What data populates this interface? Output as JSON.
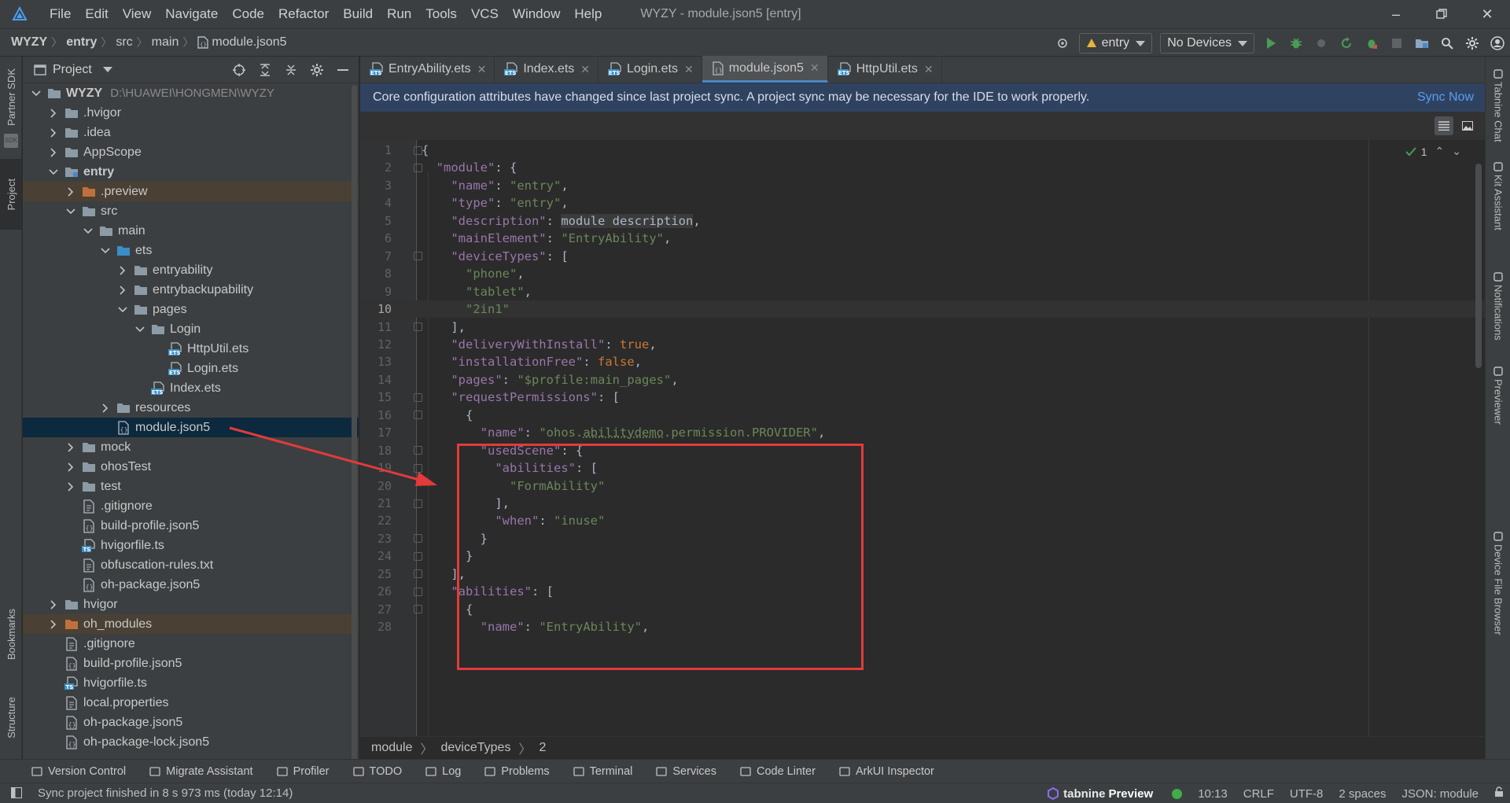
{
  "menubar": {
    "items": [
      "File",
      "Edit",
      "View",
      "Navigate",
      "Code",
      "Refactor",
      "Build",
      "Run",
      "Tools",
      "VCS",
      "Window",
      "Help"
    ],
    "window_title": "WYZY - module.json5 [entry]"
  },
  "navbar": {
    "breadcrumb": [
      "WYZY",
      "entry",
      "src",
      "main",
      "module.json5"
    ],
    "module_combo": "entry",
    "device_combo": "No Devices"
  },
  "left_strip": {
    "tabs": [
      "Partner SDK",
      "Project",
      "Bookmarks",
      "Structure"
    ]
  },
  "project": {
    "title": "Project",
    "root_path": "D:\\HUAWEI\\HONGMEN\\WYZY",
    "tree": [
      {
        "label": "WYZY",
        "depth": 0,
        "open": true,
        "icon": "folder-icon",
        "bold": true
      },
      {
        "label": ".hvigor",
        "depth": 1,
        "open": false,
        "icon": "folder-icon"
      },
      {
        "label": ".idea",
        "depth": 1,
        "open": false,
        "icon": "folder-icon"
      },
      {
        "label": "AppScope",
        "depth": 1,
        "open": false,
        "icon": "folder-icon"
      },
      {
        "label": "entry",
        "depth": 1,
        "open": true,
        "icon": "module-folder-icon",
        "bold": true
      },
      {
        "label": ".preview",
        "depth": 2,
        "open": false,
        "icon": "orange-folder-icon",
        "highlight": true
      },
      {
        "label": "src",
        "depth": 2,
        "open": true,
        "icon": "folder-icon"
      },
      {
        "label": "main",
        "depth": 3,
        "open": true,
        "icon": "folder-icon"
      },
      {
        "label": "ets",
        "depth": 4,
        "open": true,
        "icon": "blue-folder-icon"
      },
      {
        "label": "entryability",
        "depth": 5,
        "open": false,
        "icon": "folder-icon"
      },
      {
        "label": "entrybackupability",
        "depth": 5,
        "open": false,
        "icon": "folder-icon"
      },
      {
        "label": "pages",
        "depth": 5,
        "open": true,
        "icon": "folder-icon"
      },
      {
        "label": "Login",
        "depth": 6,
        "open": true,
        "icon": "folder-icon"
      },
      {
        "label": "HttpUtil.ets",
        "depth": 7,
        "icon": "ets-file-icon"
      },
      {
        "label": "Login.ets",
        "depth": 7,
        "icon": "ets-file-icon"
      },
      {
        "label": "Index.ets",
        "depth": 6,
        "icon": "ets-file-icon"
      },
      {
        "label": "resources",
        "depth": 4,
        "open": false,
        "icon": "folder-icon"
      },
      {
        "label": "module.json5",
        "depth": 4,
        "icon": "json-file-icon",
        "selected": true
      },
      {
        "label": "mock",
        "depth": 2,
        "open": false,
        "icon": "folder-icon"
      },
      {
        "label": "ohosTest",
        "depth": 2,
        "open": false,
        "icon": "folder-icon"
      },
      {
        "label": "test",
        "depth": 2,
        "open": false,
        "icon": "folder-icon"
      },
      {
        "label": ".gitignore",
        "depth": 2,
        "icon": "text-file-icon"
      },
      {
        "label": "build-profile.json5",
        "depth": 2,
        "icon": "json-file-icon"
      },
      {
        "label": "hvigorfile.ts",
        "depth": 2,
        "icon": "ts-file-icon"
      },
      {
        "label": "obfuscation-rules.txt",
        "depth": 2,
        "icon": "text-file-icon"
      },
      {
        "label": "oh-package.json5",
        "depth": 2,
        "icon": "json-file-icon"
      },
      {
        "label": "hvigor",
        "depth": 1,
        "open": false,
        "icon": "folder-icon"
      },
      {
        "label": "oh_modules",
        "depth": 1,
        "open": false,
        "icon": "orange-folder-icon",
        "highlight": true
      },
      {
        "label": ".gitignore",
        "depth": 1,
        "icon": "text-file-icon"
      },
      {
        "label": "build-profile.json5",
        "depth": 1,
        "icon": "json-file-icon"
      },
      {
        "label": "hvigorfile.ts",
        "depth": 1,
        "icon": "ts-file-icon"
      },
      {
        "label": "local.properties",
        "depth": 1,
        "icon": "text-file-icon"
      },
      {
        "label": "oh-package.json5",
        "depth": 1,
        "icon": "json-file-icon"
      },
      {
        "label": "oh-package-lock.json5",
        "depth": 1,
        "icon": "json-file-icon"
      }
    ]
  },
  "editor": {
    "tabs": [
      {
        "label": "EntryAbility.ets",
        "icon": "ets-file-icon"
      },
      {
        "label": "Index.ets",
        "icon": "ets-file-icon"
      },
      {
        "label": "Login.ets",
        "icon": "ets-file-icon"
      },
      {
        "label": "module.json5",
        "icon": "json-file-icon",
        "active": true
      },
      {
        "label": "HttpUtil.ets",
        "icon": "ets-file-icon"
      }
    ],
    "banner_text": "Core configuration attributes have changed since last project sync. A project sync may be necessary for the IDE to work properly.",
    "banner_action": "Sync Now",
    "inspection_count": "1",
    "current_line": 10,
    "lines": [
      "{",
      "  \"module\": {",
      "    \"name\": \"entry\",",
      "    \"type\": \"entry\",",
      "    \"description\": module description,",
      "    \"mainElement\": \"EntryAbility\",",
      "    \"deviceTypes\": [",
      "      \"phone\",",
      "      \"tablet\",",
      "      \"2in1\"",
      "    ],",
      "    \"deliveryWithInstall\": true,",
      "    \"installationFree\": false,",
      "    \"pages\": \"$profile:main_pages\",",
      "    \"requestPermissions\": [",
      "      {",
      "        \"name\": \"ohos.abilitydemo.permission.PROVIDER\",",
      "        \"usedScene\": {",
      "          \"abilities\": [",
      "            \"FormAbility\"",
      "          ],",
      "          \"when\": \"inuse\"",
      "        }",
      "      }",
      "    ],",
      "    \"abilities\": [",
      "      {",
      "        \"name\": \"EntryAbility\","
    ],
    "crumbs": [
      "module",
      "deviceTypes",
      "2"
    ]
  },
  "right_strip": {
    "tabs": [
      "Tabnine Chat",
      "Kit Assistant",
      "Notifications",
      "Previewer",
      "Device File Browser"
    ]
  },
  "bottom_tools": [
    "Version Control",
    "Migrate Assistant",
    "Profiler",
    "TODO",
    "Log",
    "Problems",
    "Terminal",
    "Services",
    "Code Linter",
    "ArkUI Inspector"
  ],
  "status": {
    "message": "Sync project finished in 8 s 973 ms (today 12:14)",
    "tabnine": "tabnine",
    "tabnine_mode": "Preview",
    "position": "10:13",
    "line_sep": "CRLF",
    "encoding": "UTF-8",
    "indent": "2 spaces",
    "schema": "JSON: module"
  },
  "colors": {
    "accent": "#4a88c7",
    "annotation_red": "#e33a3a",
    "banner": "#2f4360"
  }
}
